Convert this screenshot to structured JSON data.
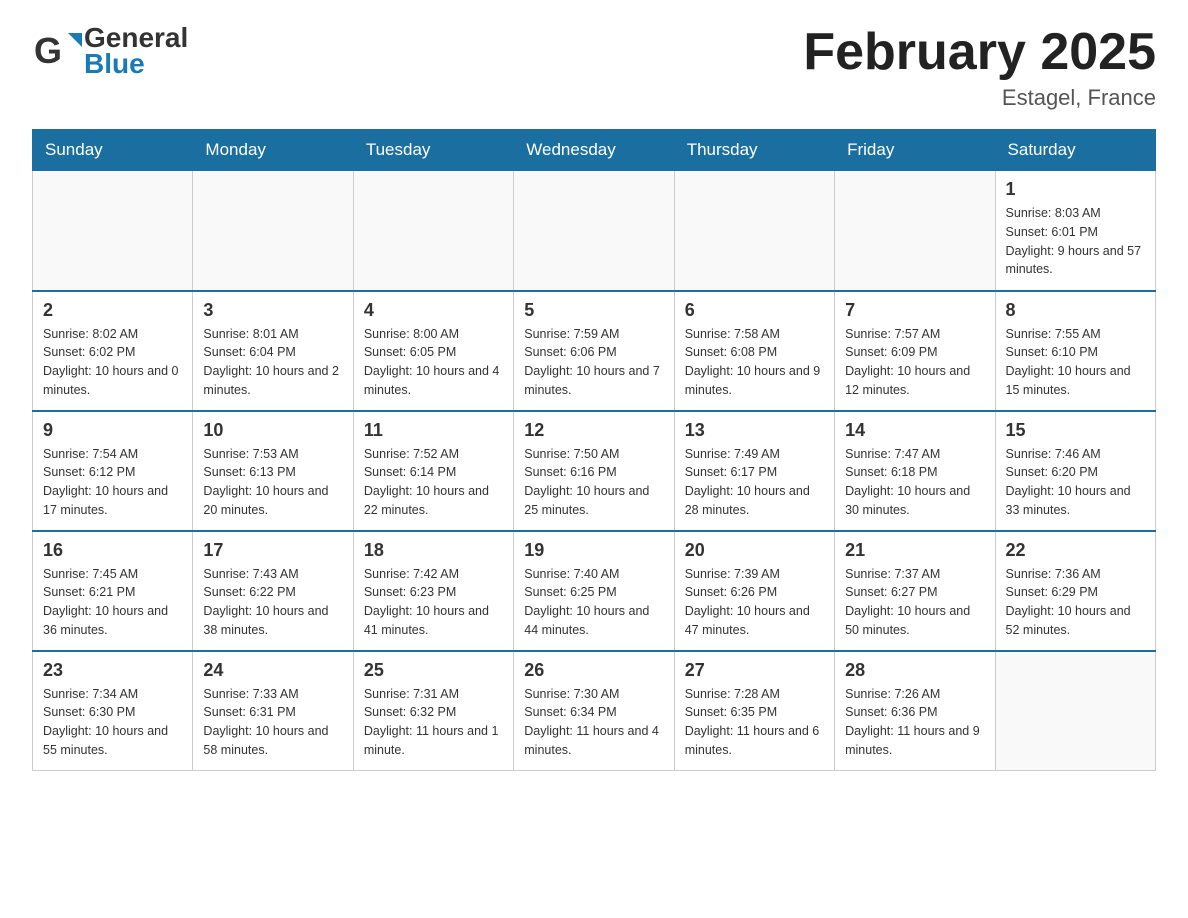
{
  "header": {
    "logo_general": "General",
    "logo_blue": "Blue",
    "title": "February 2025",
    "location": "Estagel, France"
  },
  "days_of_week": [
    "Sunday",
    "Monday",
    "Tuesday",
    "Wednesday",
    "Thursday",
    "Friday",
    "Saturday"
  ],
  "weeks": [
    {
      "days": [
        {
          "num": "",
          "info": ""
        },
        {
          "num": "",
          "info": ""
        },
        {
          "num": "",
          "info": ""
        },
        {
          "num": "",
          "info": ""
        },
        {
          "num": "",
          "info": ""
        },
        {
          "num": "",
          "info": ""
        },
        {
          "num": "1",
          "info": "Sunrise: 8:03 AM\nSunset: 6:01 PM\nDaylight: 9 hours and 57 minutes."
        }
      ]
    },
    {
      "days": [
        {
          "num": "2",
          "info": "Sunrise: 8:02 AM\nSunset: 6:02 PM\nDaylight: 10 hours and 0 minutes."
        },
        {
          "num": "3",
          "info": "Sunrise: 8:01 AM\nSunset: 6:04 PM\nDaylight: 10 hours and 2 minutes."
        },
        {
          "num": "4",
          "info": "Sunrise: 8:00 AM\nSunset: 6:05 PM\nDaylight: 10 hours and 4 minutes."
        },
        {
          "num": "5",
          "info": "Sunrise: 7:59 AM\nSunset: 6:06 PM\nDaylight: 10 hours and 7 minutes."
        },
        {
          "num": "6",
          "info": "Sunrise: 7:58 AM\nSunset: 6:08 PM\nDaylight: 10 hours and 9 minutes."
        },
        {
          "num": "7",
          "info": "Sunrise: 7:57 AM\nSunset: 6:09 PM\nDaylight: 10 hours and 12 minutes."
        },
        {
          "num": "8",
          "info": "Sunrise: 7:55 AM\nSunset: 6:10 PM\nDaylight: 10 hours and 15 minutes."
        }
      ]
    },
    {
      "days": [
        {
          "num": "9",
          "info": "Sunrise: 7:54 AM\nSunset: 6:12 PM\nDaylight: 10 hours and 17 minutes."
        },
        {
          "num": "10",
          "info": "Sunrise: 7:53 AM\nSunset: 6:13 PM\nDaylight: 10 hours and 20 minutes."
        },
        {
          "num": "11",
          "info": "Sunrise: 7:52 AM\nSunset: 6:14 PM\nDaylight: 10 hours and 22 minutes."
        },
        {
          "num": "12",
          "info": "Sunrise: 7:50 AM\nSunset: 6:16 PM\nDaylight: 10 hours and 25 minutes."
        },
        {
          "num": "13",
          "info": "Sunrise: 7:49 AM\nSunset: 6:17 PM\nDaylight: 10 hours and 28 minutes."
        },
        {
          "num": "14",
          "info": "Sunrise: 7:47 AM\nSunset: 6:18 PM\nDaylight: 10 hours and 30 minutes."
        },
        {
          "num": "15",
          "info": "Sunrise: 7:46 AM\nSunset: 6:20 PM\nDaylight: 10 hours and 33 minutes."
        }
      ]
    },
    {
      "days": [
        {
          "num": "16",
          "info": "Sunrise: 7:45 AM\nSunset: 6:21 PM\nDaylight: 10 hours and 36 minutes."
        },
        {
          "num": "17",
          "info": "Sunrise: 7:43 AM\nSunset: 6:22 PM\nDaylight: 10 hours and 38 minutes."
        },
        {
          "num": "18",
          "info": "Sunrise: 7:42 AM\nSunset: 6:23 PM\nDaylight: 10 hours and 41 minutes."
        },
        {
          "num": "19",
          "info": "Sunrise: 7:40 AM\nSunset: 6:25 PM\nDaylight: 10 hours and 44 minutes."
        },
        {
          "num": "20",
          "info": "Sunrise: 7:39 AM\nSunset: 6:26 PM\nDaylight: 10 hours and 47 minutes."
        },
        {
          "num": "21",
          "info": "Sunrise: 7:37 AM\nSunset: 6:27 PM\nDaylight: 10 hours and 50 minutes."
        },
        {
          "num": "22",
          "info": "Sunrise: 7:36 AM\nSunset: 6:29 PM\nDaylight: 10 hours and 52 minutes."
        }
      ]
    },
    {
      "days": [
        {
          "num": "23",
          "info": "Sunrise: 7:34 AM\nSunset: 6:30 PM\nDaylight: 10 hours and 55 minutes."
        },
        {
          "num": "24",
          "info": "Sunrise: 7:33 AM\nSunset: 6:31 PM\nDaylight: 10 hours and 58 minutes."
        },
        {
          "num": "25",
          "info": "Sunrise: 7:31 AM\nSunset: 6:32 PM\nDaylight: 11 hours and 1 minute."
        },
        {
          "num": "26",
          "info": "Sunrise: 7:30 AM\nSunset: 6:34 PM\nDaylight: 11 hours and 4 minutes."
        },
        {
          "num": "27",
          "info": "Sunrise: 7:28 AM\nSunset: 6:35 PM\nDaylight: 11 hours and 6 minutes."
        },
        {
          "num": "28",
          "info": "Sunrise: 7:26 AM\nSunset: 6:36 PM\nDaylight: 11 hours and 9 minutes."
        },
        {
          "num": "",
          "info": ""
        }
      ]
    }
  ]
}
